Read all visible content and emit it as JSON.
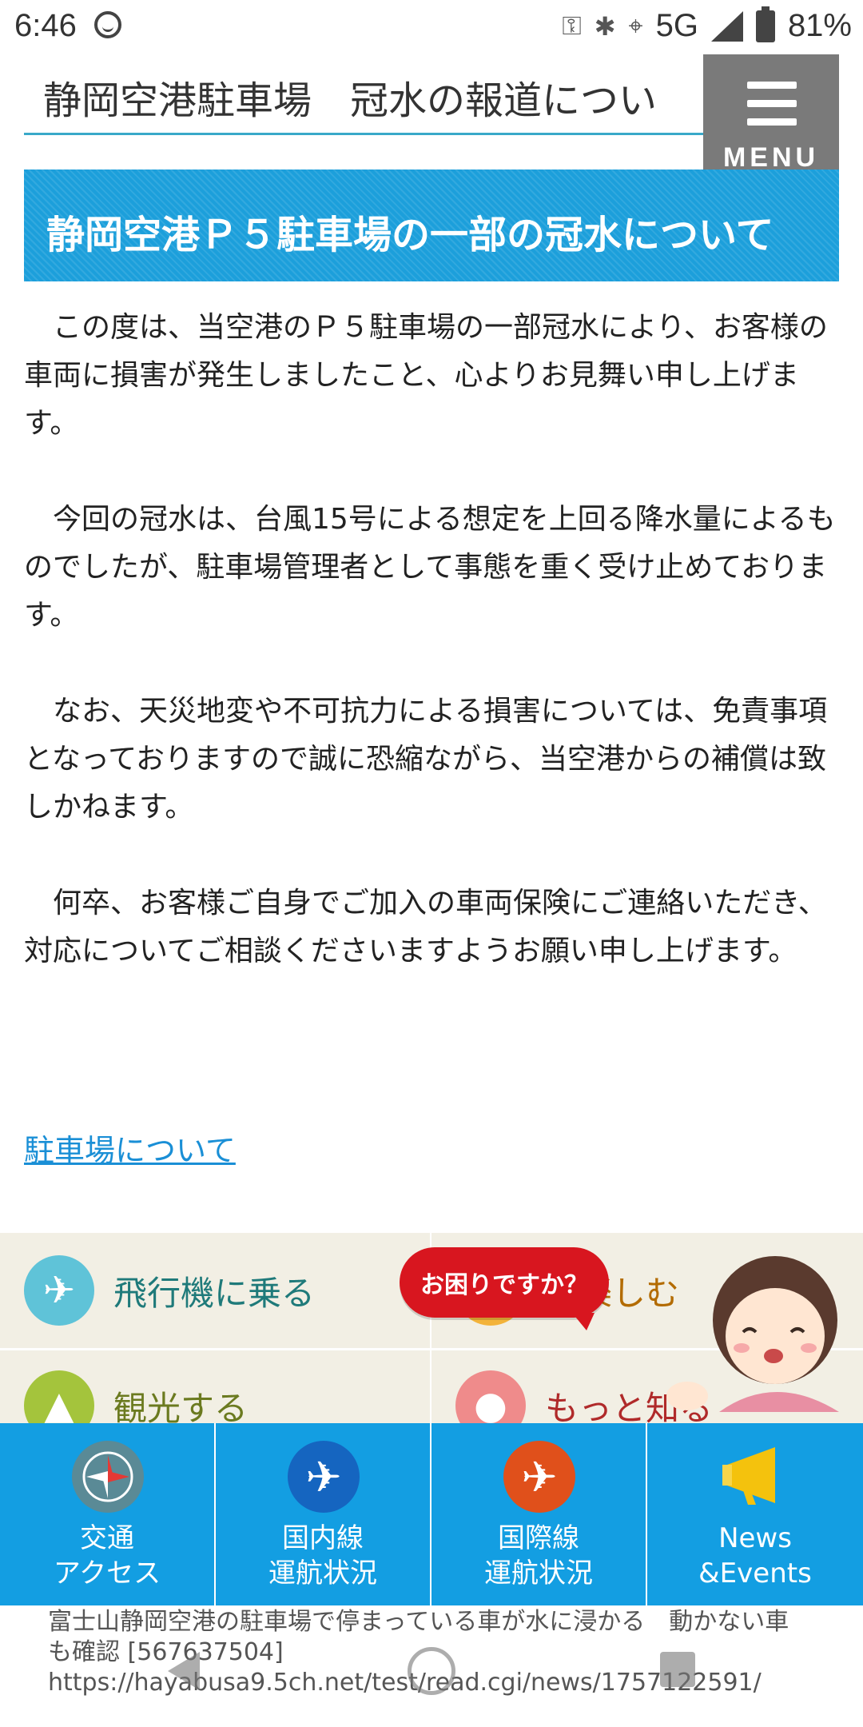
{
  "status_bar": {
    "time": "6:46",
    "network": "5G",
    "battery": "81%"
  },
  "header": {
    "title": "静岡空港駐車場　冠水の報道につい",
    "menu_label": "MENU"
  },
  "section": {
    "heading": "静岡空港Ｐ５駐車場の一部の冠水について"
  },
  "article": {
    "paragraphs": [
      "この度は、当空港のＰ５駐車場の一部冠水により、お客様の車両に損害が発生しましたこと、心よりお見舞い申し上げます。",
      "今回の冠水は、台風15号による想定を上回る降水量によるものでしたが、駐車場管理者として事態を重く受け止めております。",
      "なお、天災地変や不可抗力による損害については、免責事項となっておりますので誠に恐縮ながら、当空港からの補償は致しかねます。",
      "何卒、お客様ご自身でご加入の車両保険にご連絡いただき、対応についてご相談くださいますようお願い申し上げます。"
    ],
    "link": "駐車場について"
  },
  "categories": {
    "items": [
      {
        "label": "飛行機に乗る",
        "icon": "airplane-icon",
        "color": "#5fc3d8",
        "text_color": "#1f7a7a"
      },
      {
        "label": "で楽しむ",
        "icon": "shopping-icon",
        "color": "#f3b33a",
        "text_color": "#b36b00"
      },
      {
        "label": "観光する",
        "icon": "mountain-icon",
        "color": "#a4c43c",
        "text_color": "#6b7a1f"
      },
      {
        "label": "もっと知る",
        "icon": "lightbulb-icon",
        "color": "#ef8b8b",
        "text_color": "#b02a2a"
      }
    ]
  },
  "help": {
    "label": "お困りですか？"
  },
  "bottom_nav": {
    "items": [
      {
        "label": "交通\nアクセス",
        "icon": "compass-icon",
        "color": "#5a8a96"
      },
      {
        "label": "国内線\n運航状況",
        "icon": "airplane-icon",
        "color": "#1565c0"
      },
      {
        "label": "国際線\n運航状況",
        "icon": "airplane-icon",
        "color": "#e0501b"
      },
      {
        "label": "News\n&Events",
        "icon": "megaphone-icon",
        "color": "#f4c20d"
      }
    ]
  },
  "caption": {
    "line1": "富士山静岡空港の駐車場で停まっている車が水に浸かる　動かない車",
    "line2": "も確認 [567637504]",
    "line3": "https://hayabusa9.5ch.net/test/read.cgi/news/1757122591/"
  }
}
